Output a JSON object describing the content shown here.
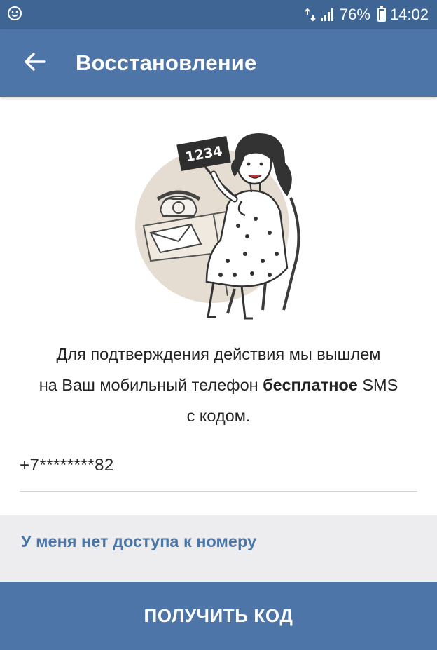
{
  "status_bar": {
    "signal_percent": "76%",
    "time": "14:02",
    "battery_level": 0.76,
    "left_icon": "notification-face-icon",
    "right_icons": [
      "data-arrows-icon",
      "signal-bars-icon",
      "battery-icon"
    ]
  },
  "app_bar": {
    "title": "Восстановление",
    "back_icon": "arrow-left-icon",
    "background": "#4d75a8",
    "status_background": "#3f6594"
  },
  "illustration": {
    "code_sign": "1234",
    "icon": "woman-holding-code-illustration"
  },
  "description": {
    "line1": "Для подтверждения действия мы вышлем",
    "line2_start": "на Ваш мобильный телефон ",
    "line2_bold": "бесплатное",
    "line2_end": " SMS",
    "line3": "с кодом."
  },
  "phone": {
    "value": "+7********82"
  },
  "no_access": {
    "label": "У меня нет доступа к номеру",
    "color": "#4a76a8"
  },
  "action": {
    "label": "ПОЛУЧИТЬ КОД"
  }
}
